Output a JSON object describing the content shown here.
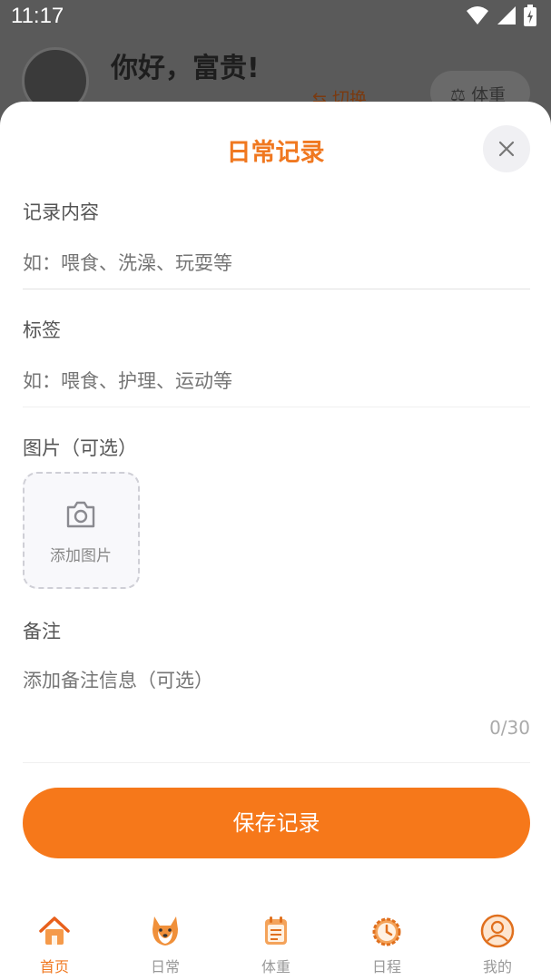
{
  "status_bar": {
    "time": "11:17"
  },
  "background": {
    "greeting": "你好，富贵!",
    "switch_label": "切换",
    "weight_chip": "体重"
  },
  "sheet": {
    "title": "日常记录",
    "content": {
      "label": "记录内容",
      "placeholder": "如：喂食、洗澡、玩耍等"
    },
    "tags": {
      "label": "标签",
      "placeholder": "如：喂食、护理、运动等"
    },
    "images": {
      "label": "图片（可选）",
      "add_label": "添加图片"
    },
    "notes": {
      "label": "备注",
      "placeholder": "添加备注信息（可选）",
      "counter": "0/30"
    },
    "save_label": "保存记录"
  },
  "bottom_nav": {
    "items": [
      {
        "label": "首页",
        "icon": "home-icon",
        "active": true
      },
      {
        "label": "日常",
        "icon": "dog-icon",
        "active": false
      },
      {
        "label": "体重",
        "icon": "calendar-note-icon",
        "active": false
      },
      {
        "label": "日程",
        "icon": "clock-icon",
        "active": false
      },
      {
        "label": "我的",
        "icon": "profile-icon",
        "active": false
      }
    ]
  },
  "colors": {
    "accent": "#f6781a",
    "title": "#f07820"
  }
}
